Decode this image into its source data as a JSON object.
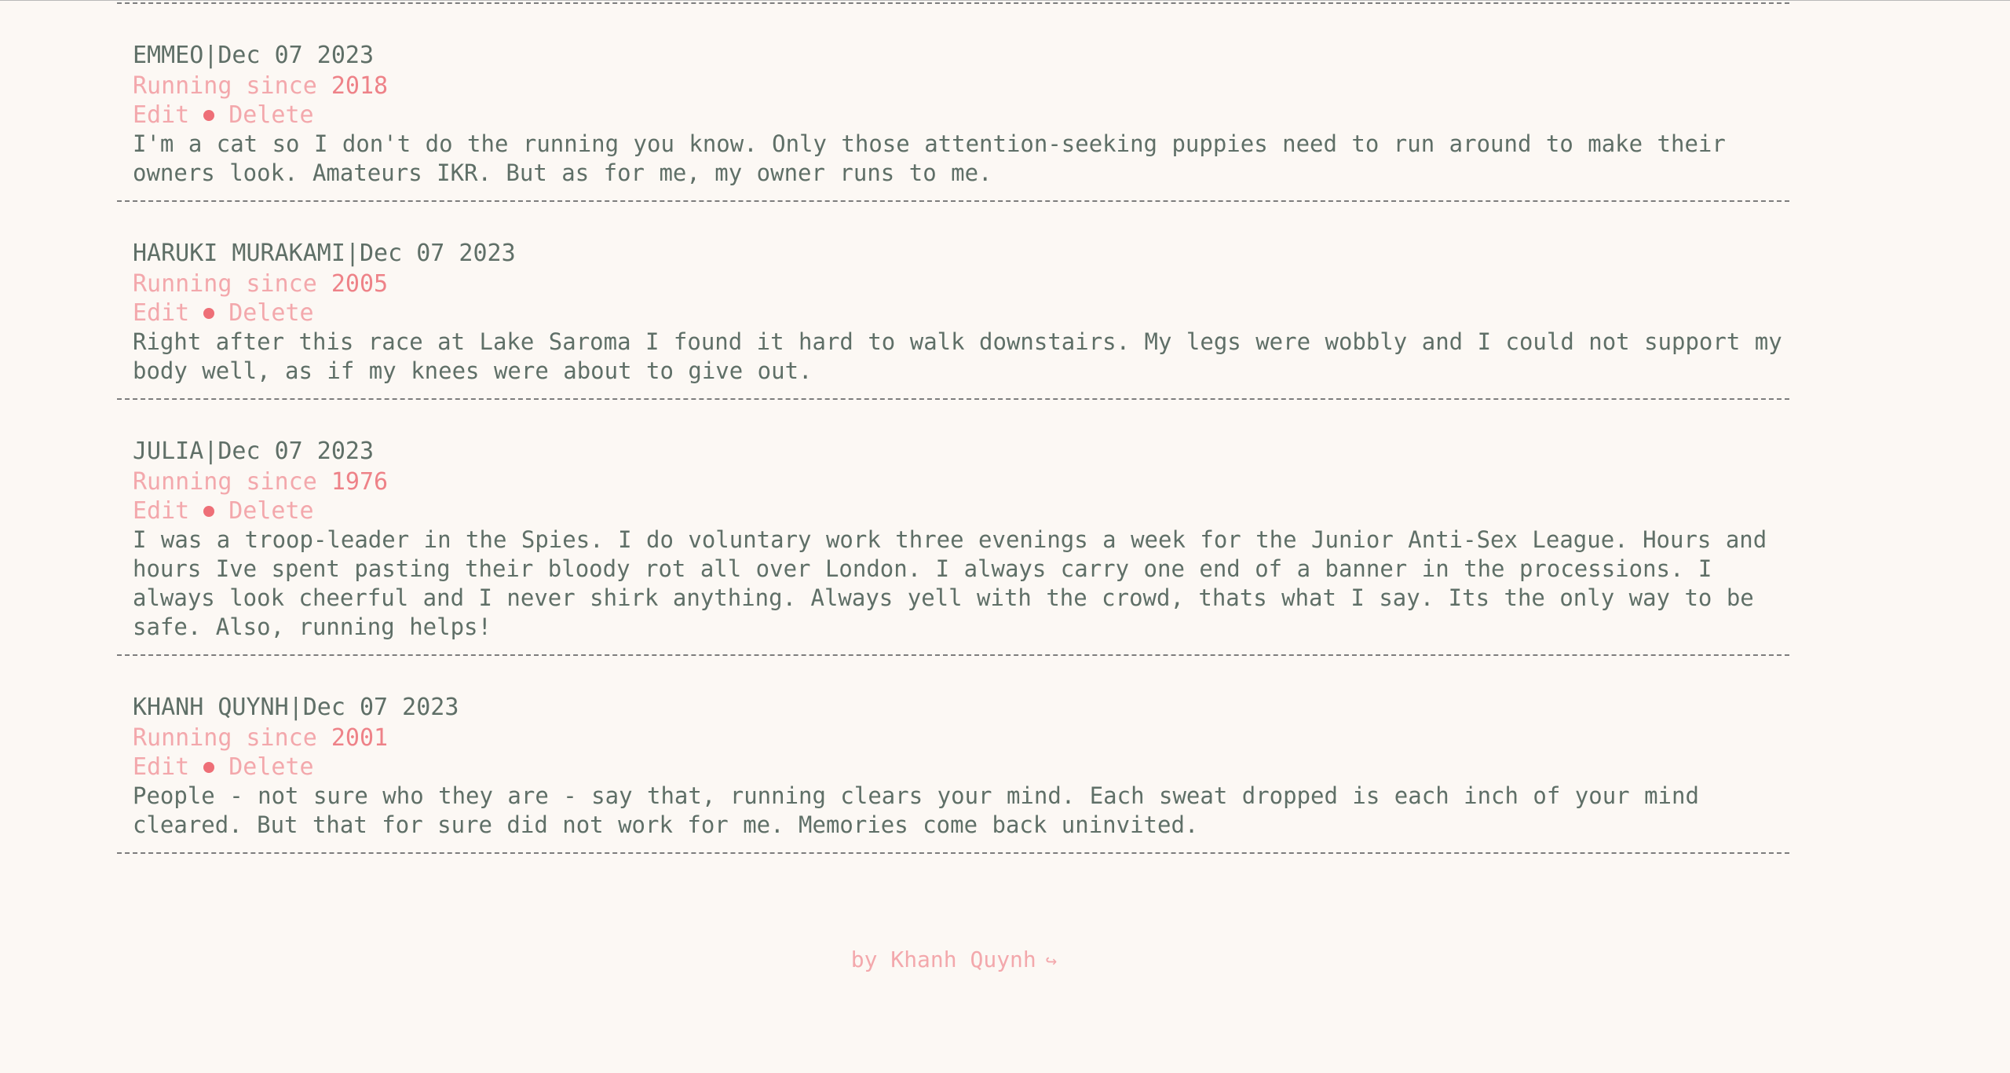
{
  "entries": [
    {
      "name": "EMMEO",
      "separator": "|",
      "date": "Dec 07 2023",
      "since_label": "Running since",
      "since_year": "2018",
      "edit_label": "Edit",
      "delete_label": "Delete",
      "text": "I'm a cat so I don't do the running you know. Only those attention-seeking puppies need to run around to make their owners look. Amateurs IKR. But as for me, my owner runs to me."
    },
    {
      "name": "HARUKI MURAKAMI",
      "separator": "|",
      "date": "Dec 07 2023",
      "since_label": "Running since",
      "since_year": "2005",
      "edit_label": "Edit",
      "delete_label": "Delete",
      "text": "Right after this race at Lake Saroma I found it hard to walk downstairs. My legs were wobbly and I could not support my body well, as if my knees were about to give out."
    },
    {
      "name": "JULIA",
      "separator": "|",
      "date": "Dec 07 2023",
      "since_label": "Running since",
      "since_year": "1976",
      "edit_label": "Edit",
      "delete_label": "Delete",
      "text": "I was a troop-leader in the Spies. I do voluntary work three evenings a week for the Junior Anti-Sex League. Hours and hours Ive spent pasting their bloody rot all over London. I always carry one end of a banner in the processions. I always look cheerful and I never shirk anything. Always yell with the crowd, thats what I say. Its the only way to be safe. Also, running helps!"
    },
    {
      "name": "KHANH QUYNH",
      "separator": "|",
      "date": "Dec 07 2023",
      "since_label": "Running since",
      "since_year": "2001",
      "edit_label": "Edit",
      "delete_label": "Delete",
      "text": "People - not sure who they are - say that, running clears your mind. Each sweat dropped is each inch of your mind cleared. But that for sure did not work for me. Memories come back uninvited."
    }
  ],
  "footer": {
    "label": "by Khanh Quynh",
    "arrow": "↪"
  }
}
